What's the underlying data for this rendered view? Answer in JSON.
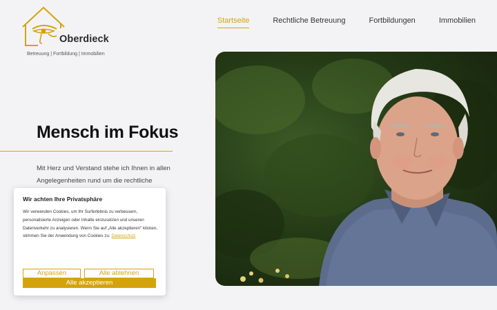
{
  "brand": {
    "name": "Oberdieck",
    "tagline": "Betreuung | Fortbildung | Immobilien",
    "accent_color": "#d4a30b"
  },
  "nav": {
    "items": [
      {
        "label": "Startseite",
        "active": true
      },
      {
        "label": "Rechtliche Betreuung",
        "active": false
      },
      {
        "label": "Fortbildungen",
        "active": false
      },
      {
        "label": "Immobilien",
        "active": false
      }
    ]
  },
  "hero": {
    "title": "Mensch im Fokus",
    "text": "Mit Herz und Verstand stehe ich Ihnen in allen Angelegenheiten rund um die rechtliche Betreuung,"
  },
  "cookie": {
    "title": "Wir achten Ihre Privatsphäre",
    "body": "Wir verwenden Cookies, um Ihr Surferlebnis zu verbessern, personalisierte Anzeigen oder Inhalte einzusetzen und unseren Datenverkehr zu analysieren. Wenn Sie auf „Alle akzeptieren\" klicken, stimmen Sie der Anwendung von Cookies zu.",
    "link": "Datenschutz",
    "customize_label": "Anpassen",
    "reject_label": "Alle ablehnen",
    "accept_label": "Alle akzeptieren"
  }
}
